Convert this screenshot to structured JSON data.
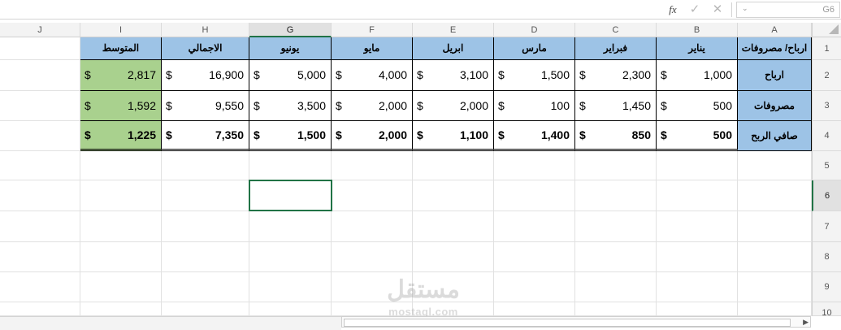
{
  "formula_bar": {
    "fx_label": "fx",
    "check_glyph": "✓",
    "cancel_glyph": "✕",
    "name_box_value": "G6",
    "name_box_arrow": "⌄"
  },
  "columns": [
    "J",
    "I",
    "H",
    "G",
    "F",
    "E",
    "D",
    "C",
    "B",
    "A"
  ],
  "rows": [
    "1",
    "2",
    "3",
    "4",
    "5",
    "6",
    "7",
    "8",
    "9",
    "10"
  ],
  "selected_column": "G",
  "selected_row": "6",
  "table": {
    "header": {
      "label": "ارباح/ مصروفات",
      "months": [
        "يناير",
        "فبراير",
        "مارس",
        "ابريل",
        "مايو",
        "يونيو"
      ],
      "total": "الاجمالي",
      "average": "المتوسط"
    },
    "currency": "$",
    "rows": [
      {
        "label": "ارباح",
        "values": [
          "1,000",
          "2,300",
          "1,500",
          "3,100",
          "4,000",
          "5,000"
        ],
        "total": "16,900",
        "average": "2,817"
      },
      {
        "label": "مصروفات",
        "values": [
          "500",
          "1,450",
          "100",
          "2,000",
          "2,000",
          "3,500"
        ],
        "total": "9,550",
        "average": "1,592"
      },
      {
        "label": "صافي الربح",
        "values": [
          "500",
          "850",
          "1,400",
          "1,100",
          "2,000",
          "1,500"
        ],
        "total": "7,350",
        "average": "1,225"
      }
    ]
  },
  "watermark": {
    "arabic": "مستقل",
    "latin": "mostaql.com"
  },
  "colors": {
    "header_blue": "#9dc3e6",
    "average_green": "#a9d18e",
    "selection": "#217346"
  }
}
